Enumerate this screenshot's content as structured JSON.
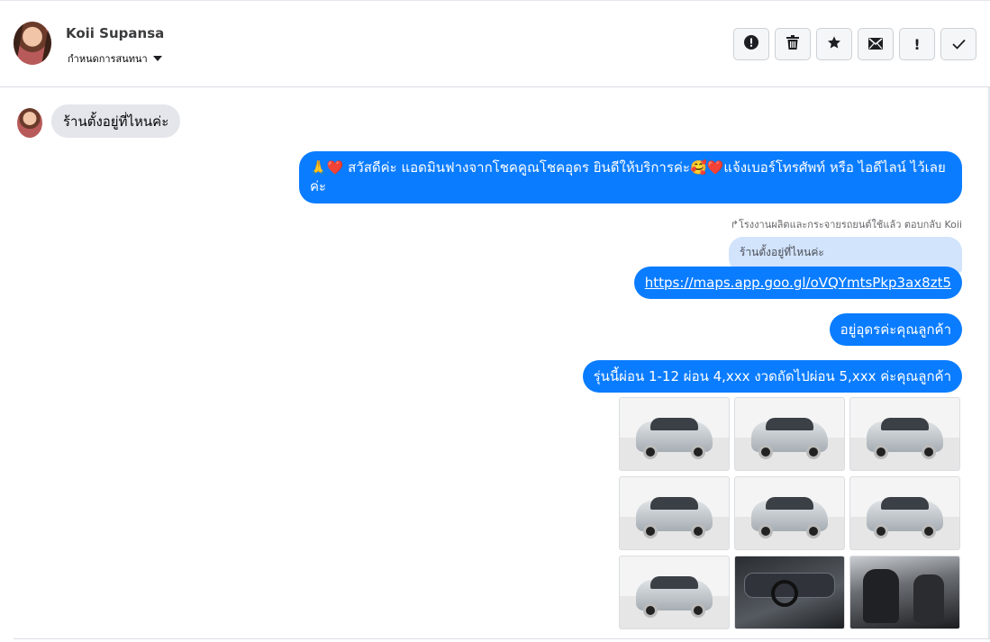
{
  "header": {
    "contact_name": "Koii Supansa",
    "conversation_setting_label": "กำหนดการสนทนา",
    "actions": [
      {
        "icon": "alert-circle-icon",
        "glyph": "❗"
      },
      {
        "icon": "trash-icon",
        "glyph": "🗑"
      },
      {
        "icon": "star-icon",
        "glyph": "★"
      },
      {
        "icon": "envelope-icon",
        "glyph": "✉"
      },
      {
        "icon": "exclamation-icon",
        "glyph": "!"
      },
      {
        "icon": "check-icon",
        "glyph": "✓"
      }
    ]
  },
  "messages": {
    "incoming_1": "ร้านตั้งอยู่ที่ไหนค่ะ",
    "outgoing_1": "🙏❤️ สวัสดีค่ะ แอดมินฟางจากโชคคูณโชคอุดร ยินดีให้บริการค่ะ🥰❤️แจ้งเบอร์โทรศัพท์ หรือ ไอดีไลน์  ไว้เลยค่ะ",
    "reply_meta": "↱โรงงานผลิตและกระจายรถยนต์ใช้แล้ว ตอบกลับ Koii",
    "quoted_text": "ร้านตั้งอยู่ที่ไหนค่ะ",
    "outgoing_link": "https://maps.app.goo.gl/oVQYmtsPkp3ax8zt5",
    "outgoing_2": "อยู่อุดรค่ะคุณลูกค้า",
    "outgoing_3": "รุ่นนี้ผ่อน 1-12 ผ่อน 4,xxx งวดถัดไปผ่อน  5,xxx ค่ะคุณลูกค้า"
  },
  "gallery": {
    "photos": [
      "car-front-left",
      "car-front",
      "car-front-right",
      "car-rear-left",
      "car-rear",
      "car-side-right",
      "car-side-left",
      "car-interior-dashboard",
      "car-interior-seats"
    ]
  }
}
